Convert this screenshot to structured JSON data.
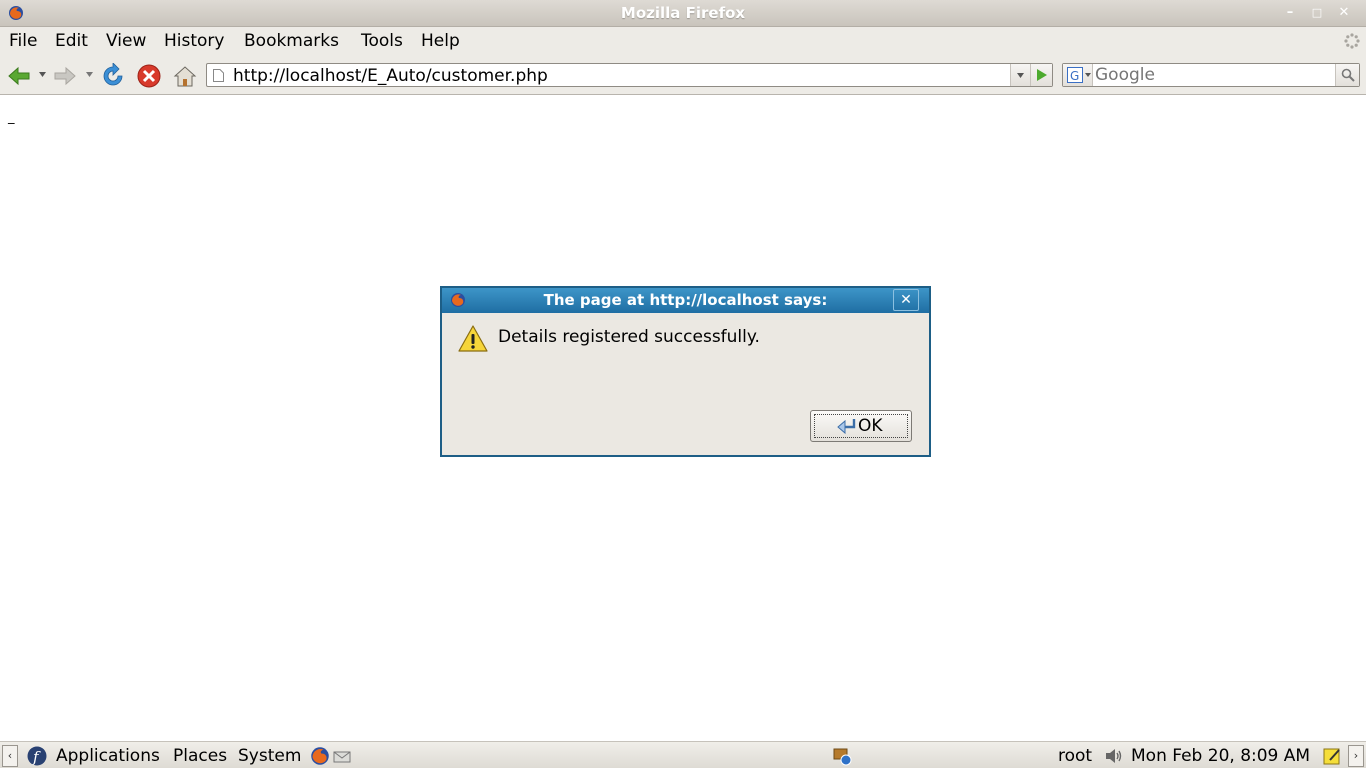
{
  "window": {
    "title": "Mozilla Firefox",
    "minimize": "–",
    "maximize": "□",
    "close": "✕"
  },
  "menubar": {
    "items": [
      "File",
      "Edit",
      "View",
      "History",
      "Bookmarks",
      "Tools",
      "Help"
    ]
  },
  "navbar": {
    "url": "http://localhost/E_Auto/customer.php",
    "search_placeholder": "Google"
  },
  "content": {
    "mark": "_"
  },
  "dialog": {
    "title": "The page at http://localhost says:",
    "close": "✕",
    "message": "Details registered successfully.",
    "ok_label": "OK"
  },
  "panel": {
    "left_arrow": "‹",
    "right_arrow": "›",
    "applications": "Applications",
    "places": "Places",
    "system": "System",
    "user": "root",
    "clock": "Mon Feb 20,  8:09 AM"
  },
  "colors": {
    "dialog_title": "#2a7fb5",
    "chrome": "#edebe6"
  }
}
